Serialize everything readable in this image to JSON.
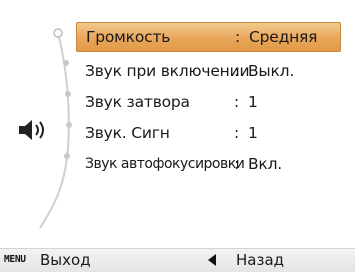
{
  "menu": {
    "items": [
      {
        "label": "Громкость",
        "colon": ":",
        "value": "Средняя",
        "selected": true
      },
      {
        "label": "Звук при включении",
        "colon": ":",
        "value": "Выкл."
      },
      {
        "label": "Звук затвора",
        "colon": ":",
        "value": "1"
      },
      {
        "label": "Звук. Сигн",
        "colon": ":",
        "value": "1"
      },
      {
        "label": "Звук автофокусировки",
        "colon": ":",
        "value": "Вкл."
      }
    ]
  },
  "footer": {
    "menu_key": "MENU",
    "exit_label": "Выход",
    "back_label": "Назад"
  },
  "icons": {
    "category": "speaker-icon",
    "back": "left-arrow-icon"
  },
  "colors": {
    "selection_top": "#f2c98e",
    "selection_bottom": "#e09a47",
    "background": "#ffffff"
  }
}
